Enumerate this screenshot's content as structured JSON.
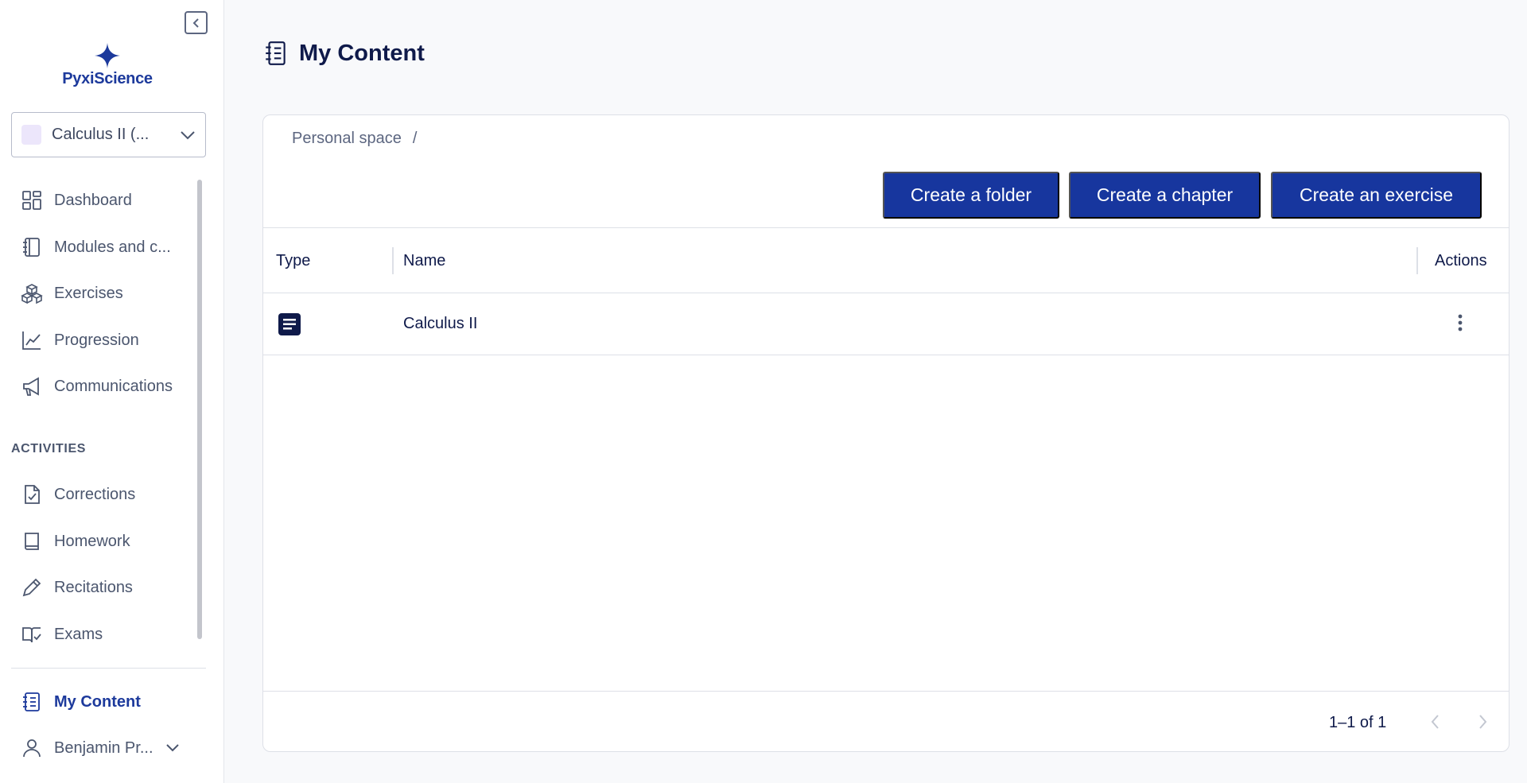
{
  "app": {
    "brand": "PyxiScience",
    "brand_color": "#1d3a9c",
    "accent_color": "#17369e"
  },
  "sidebar": {
    "course_selector": {
      "value": "Calculus II (..."
    },
    "main_items": [
      {
        "label": "Dashboard",
        "icon": "dashboard-icon"
      },
      {
        "label": "Modules and c...",
        "icon": "notebook-icon"
      },
      {
        "label": "Exercises",
        "icon": "cubes-icon"
      },
      {
        "label": "Progression",
        "icon": "chart-line-icon"
      },
      {
        "label": "Communications",
        "icon": "megaphone-icon"
      }
    ],
    "section_title": "ACTIVITIES",
    "activity_items": [
      {
        "label": "Corrections",
        "icon": "file-check-icon"
      },
      {
        "label": "Homework",
        "icon": "book-icon"
      },
      {
        "label": "Recitations",
        "icon": "pencil-icon"
      },
      {
        "label": "Exams",
        "icon": "book-open-check-icon"
      }
    ],
    "my_content": {
      "label": "My Content",
      "icon": "notebook-list-icon",
      "active": true
    },
    "user": {
      "label": "Benjamin Pr...",
      "icon": "user-icon"
    }
  },
  "header": {
    "title": "My Content"
  },
  "content": {
    "breadcrumb": {
      "root": "Personal space",
      "separator": "/"
    },
    "buttons": {
      "create_folder": "Create a folder",
      "create_chapter": "Create a chapter",
      "create_exercise": "Create an exercise"
    },
    "table": {
      "columns": [
        "Type",
        "Name",
        "Actions"
      ],
      "rows": [
        {
          "type_icon": "document-icon",
          "name": "Calculus II"
        }
      ]
    },
    "pagination": {
      "text": "1–1 of 1"
    }
  }
}
